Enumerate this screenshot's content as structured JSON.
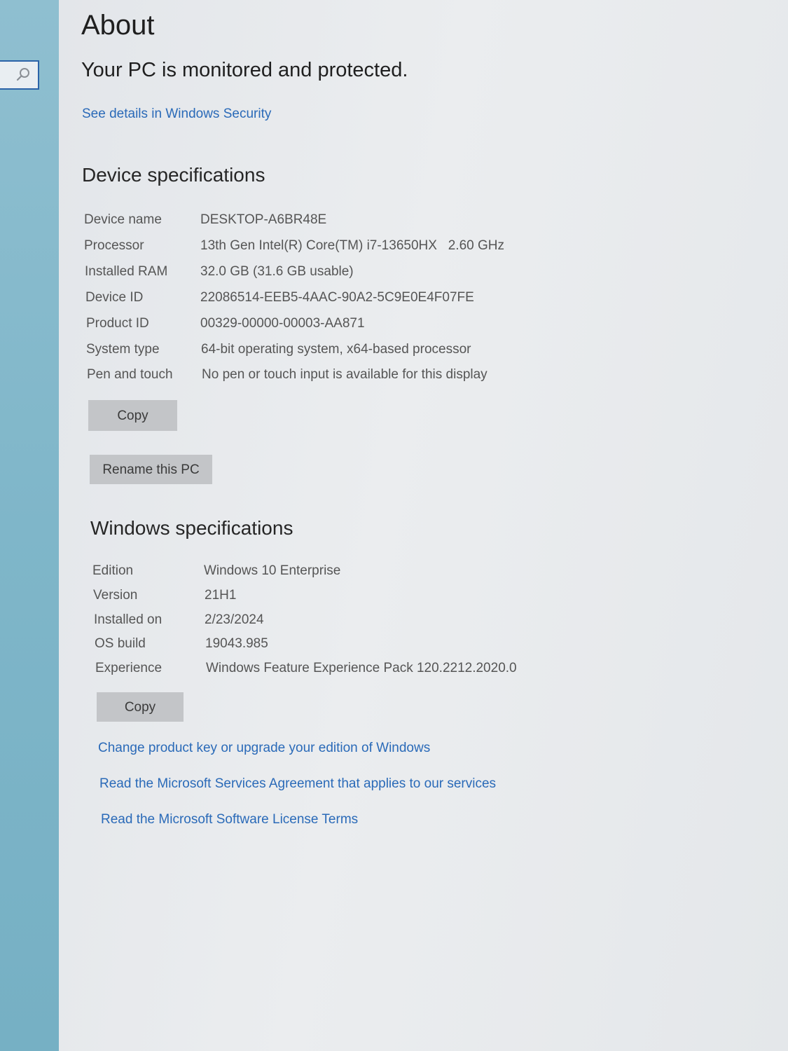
{
  "sidebar": {
    "search_icon": "search-icon"
  },
  "header": {
    "title": "About"
  },
  "security": {
    "status": "Your PC is monitored and protected.",
    "link": "See details in Windows Security"
  },
  "device_specs": {
    "title": "Device specifications",
    "rows": [
      {
        "label": "Device name",
        "value": "DESKTOP-A6BR48E"
      },
      {
        "label": "Processor",
        "value": "13th Gen Intel(R) Core(TM) i7-13650HX   2.60 GHz"
      },
      {
        "label": "Installed RAM",
        "value": "32.0 GB (31.6 GB usable)"
      },
      {
        "label": "Device ID",
        "value": "22086514-EEB5-4AAC-90A2-5C9E0E4F07FE"
      },
      {
        "label": "Product ID",
        "value": "00329-00000-00003-AA871"
      },
      {
        "label": "System type",
        "value": "64-bit operating system, x64-based processor"
      },
      {
        "label": "Pen and touch",
        "value": "No pen or touch input is available for this display"
      }
    ],
    "copy_label": "Copy",
    "rename_label": "Rename this PC"
  },
  "windows_specs": {
    "title": "Windows specifications",
    "rows": [
      {
        "label": "Edition",
        "value": "Windows 10 Enterprise"
      },
      {
        "label": "Version",
        "value": "21H1"
      },
      {
        "label": "Installed on",
        "value": "2/23/2024"
      },
      {
        "label": "OS build",
        "value": "19043.985"
      },
      {
        "label": "Experience",
        "value": "Windows Feature Experience Pack 120.2212.2020.0"
      }
    ],
    "copy_label": "Copy"
  },
  "links": {
    "product_key": "Change product key or upgrade your edition of Windows",
    "services_agreement": "Read the Microsoft Services Agreement that applies to our services",
    "license_terms": "Read the Microsoft Software License Terms"
  },
  "colors": {
    "link": "#2a6ab8",
    "sidebar": "#7fb6c9",
    "button": "#c3c5c8"
  }
}
